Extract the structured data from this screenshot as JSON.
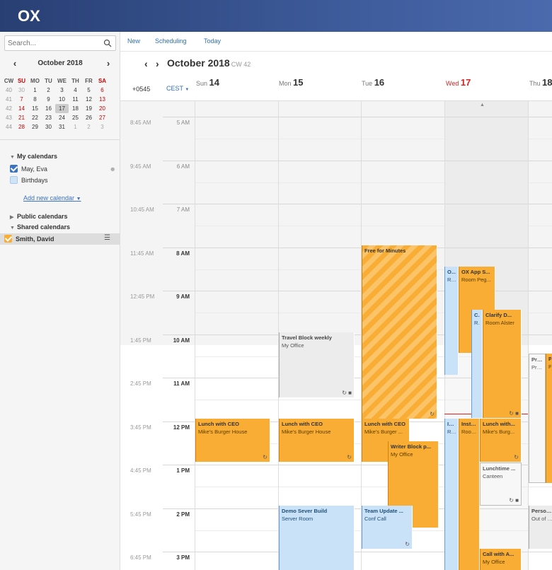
{
  "app": {
    "logo": "OX"
  },
  "search": {
    "placeholder": "Search..."
  },
  "mini": {
    "title": "October 2018",
    "headers": [
      "CW",
      "SU",
      "MO",
      "TU",
      "WE",
      "TH",
      "FR",
      "SA"
    ],
    "rows": [
      [
        "40",
        "30",
        "1",
        "2",
        "3",
        "4",
        "5",
        "6"
      ],
      [
        "41",
        "7",
        "8",
        "9",
        "10",
        "11",
        "12",
        "13"
      ],
      [
        "42",
        "14",
        "15",
        "16",
        "17",
        "18",
        "19",
        "20"
      ],
      [
        "43",
        "21",
        "22",
        "23",
        "24",
        "25",
        "26",
        "27"
      ],
      [
        "44",
        "28",
        "29",
        "30",
        "31",
        "1",
        "2",
        "3"
      ]
    ]
  },
  "sidebar": {
    "my_calendars": "My calendars",
    "cal1": "May, Eva",
    "cal2": "Birthdays",
    "add": "Add new calendar",
    "public": "Public calendars",
    "shared": "Shared calendars",
    "shared1": "Smith, David"
  },
  "toolbar": {
    "new": "New",
    "scheduling": "Scheduling",
    "today": "Today"
  },
  "nav": {
    "title": "October 2018",
    "cw": "CW 42"
  },
  "tz": {
    "secondary": "+0545",
    "primary": "CEST"
  },
  "days": [
    {
      "name": "Sun",
      "num": "14"
    },
    {
      "name": "Mon",
      "num": "15"
    },
    {
      "name": "Tue",
      "num": "16"
    },
    {
      "name": "Wed",
      "num": "17"
    },
    {
      "name": "Thu",
      "num": "18"
    }
  ],
  "times1": [
    "8:45 AM",
    "9:45 AM",
    "10:45 AM",
    "11:45 AM",
    "12:45 PM",
    "1:45 PM",
    "2:45 PM",
    "3:45 PM",
    "4:45 PM",
    "5:45 PM",
    "6:45 PM"
  ],
  "times2": [
    "5 AM",
    "6 AM",
    "7 AM",
    "8 AM",
    "9 AM",
    "10 AM",
    "11 AM",
    "12 PM",
    "1 PM",
    "2 PM",
    "3 PM"
  ],
  "events": {
    "sun_lunch": {
      "t": "Lunch with CEO",
      "l": "Mike's Burger House"
    },
    "mon_travel": {
      "t": "Travel Block weekly",
      "l": "My Office"
    },
    "mon_lunch": {
      "t": "Lunch with CEO",
      "l": "Mike's Burger House"
    },
    "mon_demo": {
      "t": "Demo Sever Build",
      "l": "Server Room"
    },
    "tue_free": {
      "t": "Free for Minutes"
    },
    "tue_lunch": {
      "t": "Lunch with CEO",
      "l": "Mike's Burger ..."
    },
    "tue_writer": {
      "t": "Writer Block p...",
      "l": "My Office"
    },
    "tue_team": {
      "t": "Team Update ...",
      "l": "Conf Call"
    },
    "wed_ox": {
      "t": "OX ...",
      "l": "Roo..."
    },
    "wed_oxapp": {
      "t": "OX App S...",
      "l": "Room Peg..."
    },
    "wed_cla": {
      "t": "Cla...",
      "l": "Roo..."
    },
    "wed_clarify": {
      "t": "Clarify D...",
      "l": "Room Alster"
    },
    "wed_inst": {
      "t": "Inst...",
      "l": "Roo..."
    },
    "wed_install": {
      "t": "Install ...",
      "l": "Room B..."
    },
    "wed_lunch": {
      "t": "Lunch with...",
      "l": "Mike's Burg..."
    },
    "wed_lunchtime": {
      "t": "Lunchtime ...",
      "l": "Canteen"
    },
    "wed_call": {
      "t": "Call with A...",
      "l": "My Office"
    },
    "thu_press": {
      "t": "Press ...",
      "l": "Press ..."
    },
    "thu_p2": {
      "t": "P...",
      "l": "P..."
    },
    "thu_personal": {
      "t": "Persona...",
      "l": "Out of O..."
    }
  },
  "colors": {
    "accent": "#3a73c2",
    "orange": "#f9ad34",
    "blue": "#c9e2f8",
    "today": "#dd2222"
  }
}
